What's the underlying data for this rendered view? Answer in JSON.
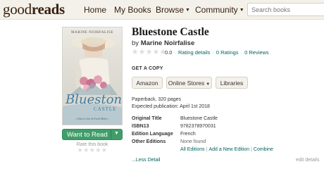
{
  "header": {
    "logo_light": "good",
    "logo_bold": "reads",
    "nav": {
      "home": "Home",
      "my_books": "My Books",
      "browse": "Browse",
      "community": "Community"
    },
    "search_placeholder": "Search books"
  },
  "book": {
    "cover": {
      "author": "MARINE NOIRFALISE",
      "title": "Bluestone",
      "subtitle": "CASTLE",
      "series": "« Dans la série de Fresh Miller »"
    },
    "title": "Bluestone Castle",
    "by_prefix": "by",
    "author": "Marine Noirfalise",
    "stars": "★★★★★",
    "rating": "0.0",
    "rating_details": "Rating details",
    "ratings_count": "0 Ratings",
    "reviews_count": "0 Reviews",
    "separator": "·"
  },
  "shelf": {
    "want_to_read": "Want to Read",
    "rate_label": "Rate this book",
    "rate_stars": "★★★★★"
  },
  "get_copy": {
    "heading": "GET A COPY",
    "buttons": [
      "Amazon",
      "Online Stores",
      "Libraries"
    ]
  },
  "publication": {
    "format": "Paperback, 320 pages",
    "expected": "Expected publication: April 1st 2018"
  },
  "details": {
    "rows": [
      {
        "label": "Original Title",
        "value": "Bluestone Castle"
      },
      {
        "label": "ISBN13",
        "value": "9782378970031"
      },
      {
        "label": "Edition Language",
        "value": "French"
      },
      {
        "label": "Other Editions",
        "value": "None found"
      }
    ],
    "edition_links": [
      "All Editions",
      "Add a New Edition",
      "Combine"
    ],
    "link_separator": "|",
    "less_detail": "...Less Detail",
    "edit_details": "edit details"
  },
  "colors": {
    "header_bg": "#f4f1ea",
    "brand_brown": "#382110",
    "link_green": "#00635d",
    "button_green": "#409d69"
  }
}
